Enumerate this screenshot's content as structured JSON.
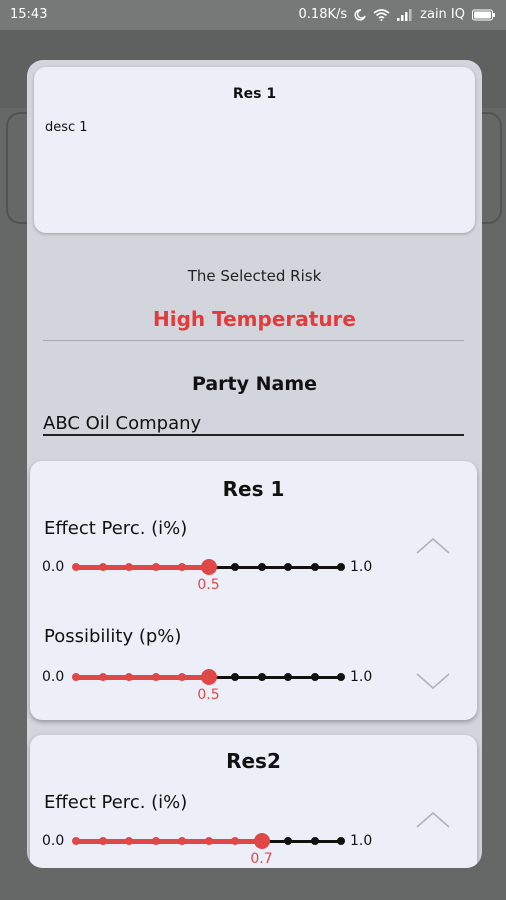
{
  "status_bar": {
    "time": "15:43",
    "speed": "0.18K/s",
    "carrier": "zain IQ"
  },
  "dialog": {
    "description_card": {
      "title": "Res 1",
      "text": "desc 1"
    },
    "selected_risk_label": "The Selected Risk",
    "selected_risk_value": "High Temperature",
    "party_name_label": "Party Name",
    "party_name_value": "ABC Oil Company",
    "accent_color": "#e04848",
    "results": [
      {
        "title": "Res 1",
        "sliders": [
          {
            "label": "Effect Perc. (i%)",
            "min_label": "0.0",
            "max_label": "1.0",
            "value": 0.5,
            "value_label": "0.5"
          },
          {
            "label": "Possibility (p%)",
            "min_label": "0.0",
            "max_label": "1.0",
            "value": 0.5,
            "value_label": "0.5"
          }
        ],
        "icons": [
          "chevron-up-icon",
          "chevron-down-icon"
        ]
      },
      {
        "title": "Res2",
        "sliders": [
          {
            "label": "Effect Perc. (i%)",
            "min_label": "0.0",
            "max_label": "1.0",
            "value": 0.7,
            "value_label": "0.7"
          }
        ],
        "icons": [
          "chevron-up-icon"
        ]
      }
    ]
  }
}
